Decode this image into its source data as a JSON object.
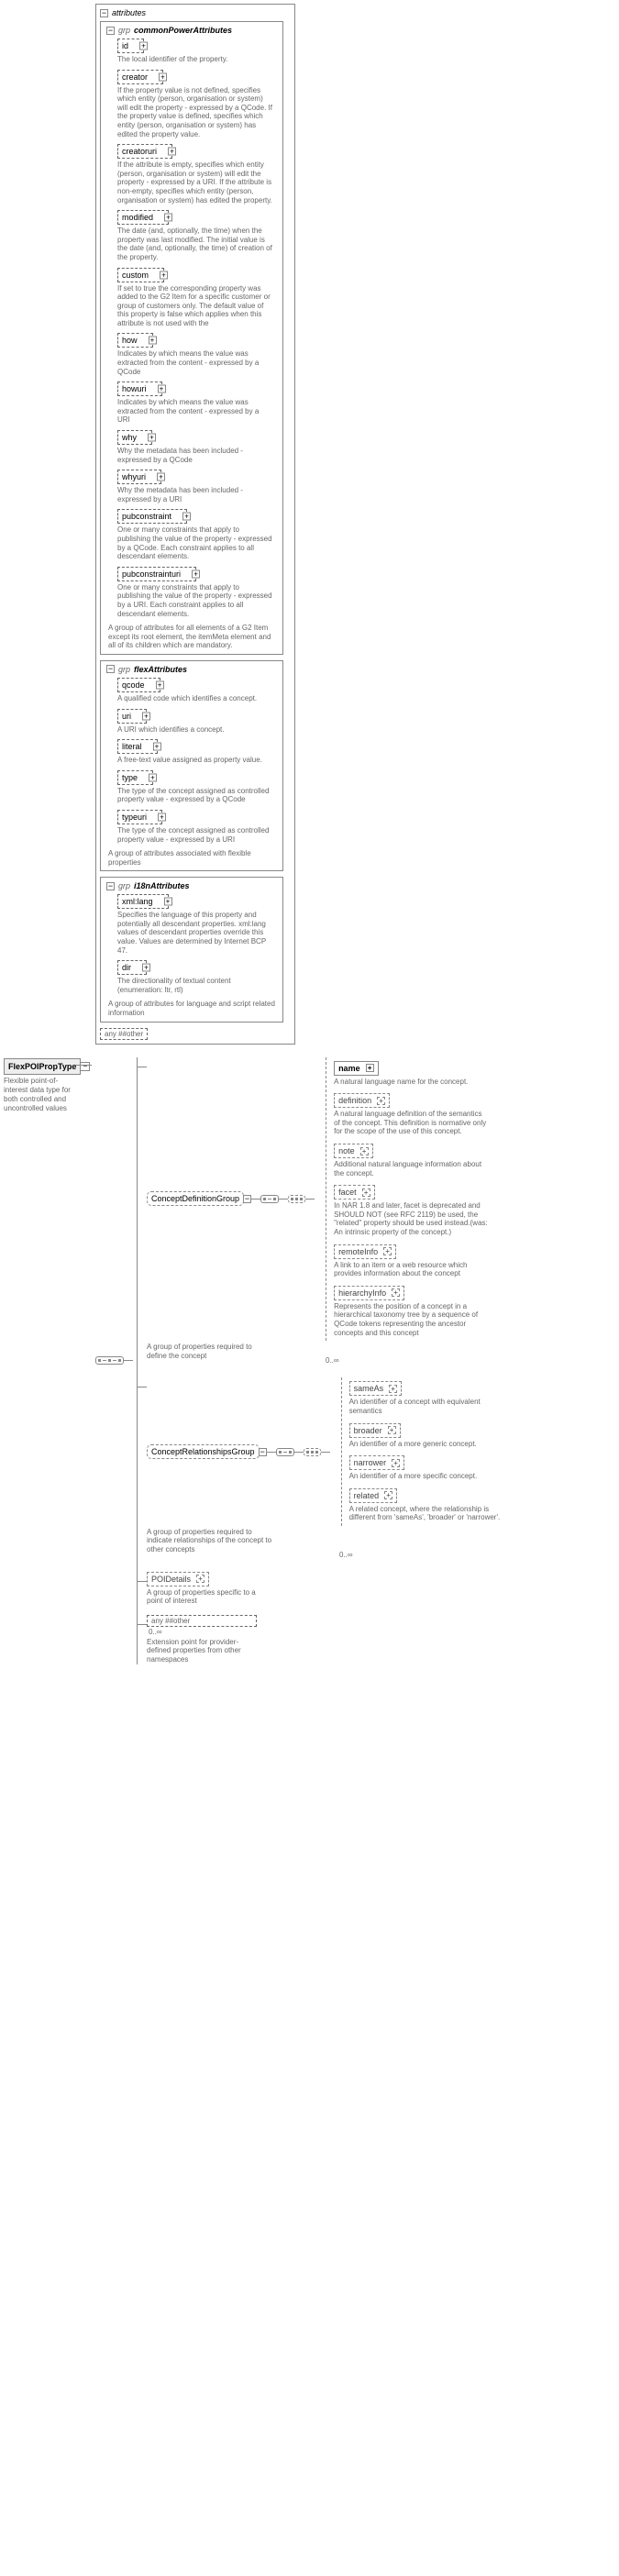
{
  "root": {
    "name": "FlexPOIPropType",
    "desc": "Flexible point-of-interest data type for both controlled and uncontrolled values"
  },
  "topFrame": {
    "attributesLabel": "attributes",
    "group1": {
      "name": "commonPowerAttributes",
      "items": [
        {
          "name": "id",
          "doc": "The local identifier of the property."
        },
        {
          "name": "creator",
          "doc": "If the property value is not defined, specifies which entity (person, organisation or system) will edit the property - expressed by a QCode. If the property value is defined, specifies which entity (person, organisation or system) has edited the property value."
        },
        {
          "name": "creatoruri",
          "doc": "If the attribute is empty, specifies which entity (person, organisation or system) will edit the property - expressed by a URI. If the attribute is non-empty, specifies which entity (person, organisation or system) has edited the property."
        },
        {
          "name": "modified",
          "doc": "The date (and, optionally, the time) when the property was last modified. The initial value is the date (and, optionally, the time) of creation of the property."
        },
        {
          "name": "custom",
          "doc": "If set to true the corresponding property was added to the G2 Item for a specific customer or group of customers only. The default value of this property is false which applies when this attribute is not used with the"
        },
        {
          "name": "how",
          "doc": "Indicates by which means the value was extracted from the content - expressed by a QCode"
        },
        {
          "name": "howuri",
          "doc": "Indicates by which means the value was extracted from the content - expressed by a URI"
        },
        {
          "name": "why",
          "doc": "Why the metadata has been included - expressed by a QCode"
        },
        {
          "name": "whyuri",
          "doc": "Why the metadata has been included - expressed by a URI"
        },
        {
          "name": "pubconstraint",
          "doc": "One or many constraints that apply to publishing the value of the property - expressed by a QCode. Each constraint applies to all descendant elements."
        },
        {
          "name": "pubconstrainturi",
          "doc": "One or many constraints that apply to publishing the value of the property - expressed by a URI. Each constraint applies to all descendant elements."
        }
      ],
      "groupDoc": "A group of attributes for all elements of a G2 Item except its root element, the itemMeta element and all of its children which are mandatory."
    },
    "group2": {
      "name": "flexAttributes",
      "items": [
        {
          "name": "qcode",
          "doc": "A qualified code which identifies a concept."
        },
        {
          "name": "uri",
          "doc": "A URI which identifies a concept."
        },
        {
          "name": "literal",
          "doc": "A free-text value assigned as property value."
        },
        {
          "name": "type",
          "doc": "The type of the concept assigned as controlled property value - expressed by a QCode"
        },
        {
          "name": "typeuri",
          "doc": "The type of the concept assigned as controlled property value - expressed by a URI"
        }
      ],
      "groupDoc": "A group of attributes associated with flexible properties"
    },
    "group3": {
      "name": "i18nAttributes",
      "items": [
        {
          "name": "xml:lang",
          "doc": "Specifies the language of this property and potentially all descendant properties. xml:lang values of descendant properties override this value. Values are determined by Internet BCP 47."
        },
        {
          "name": "dir",
          "doc": "The directionality of textual content (enumeration: ltr, rtl)"
        }
      ],
      "groupDoc": "A group of attributes for language and script related information"
    },
    "anyOther": "any ##other"
  },
  "seq": {
    "groups": [
      {
        "name": "ConceptDefinitionGroup",
        "doc": "A group of properties required to define the concept",
        "occurs": "0..∞",
        "leaves": [
          {
            "name": "name",
            "bold": true,
            "doc": "A natural language name for the concept."
          },
          {
            "name": "definition",
            "doc": "A natural language definition of the semantics of the concept. This definition is normative only for the scope of the use of this concept."
          },
          {
            "name": "note",
            "doc": "Additional natural language information about the concept."
          },
          {
            "name": "facet",
            "doc": "In NAR 1.8 and later, facet is deprecated and SHOULD NOT (see RFC 2119) be used, the \"related\" property should be used instead.(was: An intrinsic property of the concept.)"
          },
          {
            "name": "remoteInfo",
            "doc": "A link to an item or a web resource which provides information about the concept"
          },
          {
            "name": "hierarchyInfo",
            "doc": "Represents the position of a concept in a hierarchical taxonomy tree by a sequence of QCode tokens representing the ancestor concepts and this concept"
          }
        ]
      },
      {
        "name": "ConceptRelationshipsGroup",
        "doc": "A group of properties required to indicate relationships of the concept to other concepts",
        "occurs": "0..∞",
        "leaves": [
          {
            "name": "sameAs",
            "doc": "An identifier of a concept with equivalent semantics"
          },
          {
            "name": "broader",
            "doc": "An identifier of a more generic concept."
          },
          {
            "name": "narrower",
            "doc": "An identifier of a more specific concept."
          },
          {
            "name": "related",
            "doc": "A related concept, where the relationship is different from 'sameAs', 'broader' or 'narrower'."
          }
        ]
      }
    ],
    "poi": {
      "name": "POIDetails",
      "doc": "A group of properties specific to a point of interest"
    },
    "anyOther": {
      "label": "any ##other",
      "occurs": "0..∞",
      "doc": "Extension point for provider-defined properties from other namespaces"
    }
  }
}
